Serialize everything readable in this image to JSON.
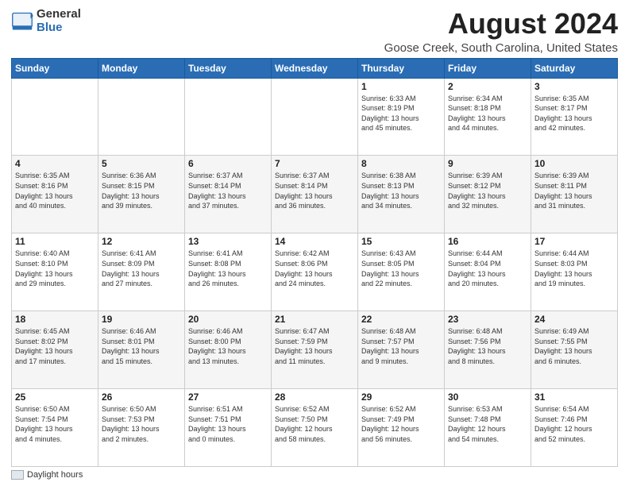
{
  "logo": {
    "general": "General",
    "blue": "Blue"
  },
  "title": "August 2024",
  "subtitle": "Goose Creek, South Carolina, United States",
  "days_of_week": [
    "Sunday",
    "Monday",
    "Tuesday",
    "Wednesday",
    "Thursday",
    "Friday",
    "Saturday"
  ],
  "footer": {
    "legend_label": "Daylight hours"
  },
  "weeks": [
    [
      {
        "day": "",
        "info": ""
      },
      {
        "day": "",
        "info": ""
      },
      {
        "day": "",
        "info": ""
      },
      {
        "day": "",
        "info": ""
      },
      {
        "day": "1",
        "info": "Sunrise: 6:33 AM\nSunset: 8:19 PM\nDaylight: 13 hours\nand 45 minutes."
      },
      {
        "day": "2",
        "info": "Sunrise: 6:34 AM\nSunset: 8:18 PM\nDaylight: 13 hours\nand 44 minutes."
      },
      {
        "day": "3",
        "info": "Sunrise: 6:35 AM\nSunset: 8:17 PM\nDaylight: 13 hours\nand 42 minutes."
      }
    ],
    [
      {
        "day": "4",
        "info": "Sunrise: 6:35 AM\nSunset: 8:16 PM\nDaylight: 13 hours\nand 40 minutes."
      },
      {
        "day": "5",
        "info": "Sunrise: 6:36 AM\nSunset: 8:15 PM\nDaylight: 13 hours\nand 39 minutes."
      },
      {
        "day": "6",
        "info": "Sunrise: 6:37 AM\nSunset: 8:14 PM\nDaylight: 13 hours\nand 37 minutes."
      },
      {
        "day": "7",
        "info": "Sunrise: 6:37 AM\nSunset: 8:14 PM\nDaylight: 13 hours\nand 36 minutes."
      },
      {
        "day": "8",
        "info": "Sunrise: 6:38 AM\nSunset: 8:13 PM\nDaylight: 13 hours\nand 34 minutes."
      },
      {
        "day": "9",
        "info": "Sunrise: 6:39 AM\nSunset: 8:12 PM\nDaylight: 13 hours\nand 32 minutes."
      },
      {
        "day": "10",
        "info": "Sunrise: 6:39 AM\nSunset: 8:11 PM\nDaylight: 13 hours\nand 31 minutes."
      }
    ],
    [
      {
        "day": "11",
        "info": "Sunrise: 6:40 AM\nSunset: 8:10 PM\nDaylight: 13 hours\nand 29 minutes."
      },
      {
        "day": "12",
        "info": "Sunrise: 6:41 AM\nSunset: 8:09 PM\nDaylight: 13 hours\nand 27 minutes."
      },
      {
        "day": "13",
        "info": "Sunrise: 6:41 AM\nSunset: 8:08 PM\nDaylight: 13 hours\nand 26 minutes."
      },
      {
        "day": "14",
        "info": "Sunrise: 6:42 AM\nSunset: 8:06 PM\nDaylight: 13 hours\nand 24 minutes."
      },
      {
        "day": "15",
        "info": "Sunrise: 6:43 AM\nSunset: 8:05 PM\nDaylight: 13 hours\nand 22 minutes."
      },
      {
        "day": "16",
        "info": "Sunrise: 6:44 AM\nSunset: 8:04 PM\nDaylight: 13 hours\nand 20 minutes."
      },
      {
        "day": "17",
        "info": "Sunrise: 6:44 AM\nSunset: 8:03 PM\nDaylight: 13 hours\nand 19 minutes."
      }
    ],
    [
      {
        "day": "18",
        "info": "Sunrise: 6:45 AM\nSunset: 8:02 PM\nDaylight: 13 hours\nand 17 minutes."
      },
      {
        "day": "19",
        "info": "Sunrise: 6:46 AM\nSunset: 8:01 PM\nDaylight: 13 hours\nand 15 minutes."
      },
      {
        "day": "20",
        "info": "Sunrise: 6:46 AM\nSunset: 8:00 PM\nDaylight: 13 hours\nand 13 minutes."
      },
      {
        "day": "21",
        "info": "Sunrise: 6:47 AM\nSunset: 7:59 PM\nDaylight: 13 hours\nand 11 minutes."
      },
      {
        "day": "22",
        "info": "Sunrise: 6:48 AM\nSunset: 7:57 PM\nDaylight: 13 hours\nand 9 minutes."
      },
      {
        "day": "23",
        "info": "Sunrise: 6:48 AM\nSunset: 7:56 PM\nDaylight: 13 hours\nand 8 minutes."
      },
      {
        "day": "24",
        "info": "Sunrise: 6:49 AM\nSunset: 7:55 PM\nDaylight: 13 hours\nand 6 minutes."
      }
    ],
    [
      {
        "day": "25",
        "info": "Sunrise: 6:50 AM\nSunset: 7:54 PM\nDaylight: 13 hours\nand 4 minutes."
      },
      {
        "day": "26",
        "info": "Sunrise: 6:50 AM\nSunset: 7:53 PM\nDaylight: 13 hours\nand 2 minutes."
      },
      {
        "day": "27",
        "info": "Sunrise: 6:51 AM\nSunset: 7:51 PM\nDaylight: 13 hours\nand 0 minutes."
      },
      {
        "day": "28",
        "info": "Sunrise: 6:52 AM\nSunset: 7:50 PM\nDaylight: 12 hours\nand 58 minutes."
      },
      {
        "day": "29",
        "info": "Sunrise: 6:52 AM\nSunset: 7:49 PM\nDaylight: 12 hours\nand 56 minutes."
      },
      {
        "day": "30",
        "info": "Sunrise: 6:53 AM\nSunset: 7:48 PM\nDaylight: 12 hours\nand 54 minutes."
      },
      {
        "day": "31",
        "info": "Sunrise: 6:54 AM\nSunset: 7:46 PM\nDaylight: 12 hours\nand 52 minutes."
      }
    ]
  ]
}
